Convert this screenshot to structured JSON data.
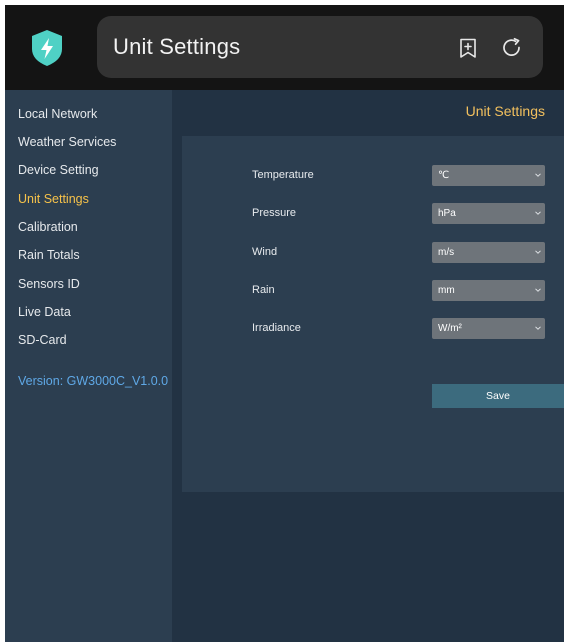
{
  "header": {
    "title": "Unit Settings"
  },
  "sidebar": {
    "items": [
      {
        "label": "Local Network",
        "active": false
      },
      {
        "label": "Weather Services",
        "active": false
      },
      {
        "label": "Device Setting",
        "active": false
      },
      {
        "label": "Unit Settings",
        "active": true
      },
      {
        "label": "Calibration",
        "active": false
      },
      {
        "label": "Rain Totals",
        "active": false
      },
      {
        "label": "Sensors ID",
        "active": false
      },
      {
        "label": "Live Data",
        "active": false
      },
      {
        "label": "SD-Card",
        "active": false
      }
    ],
    "version": "Version: GW3000C_V1.0.0"
  },
  "main": {
    "heading": "Unit Settings",
    "fields": [
      {
        "label": "Temperature",
        "value": "℃"
      },
      {
        "label": "Pressure",
        "value": "hPa"
      },
      {
        "label": "Wind",
        "value": "m/s"
      },
      {
        "label": "Rain",
        "value": "mm"
      },
      {
        "label": "Irradiance",
        "value": "W/m²"
      }
    ],
    "save_label": "Save"
  },
  "icons": {
    "app": "lightning-shield-icon",
    "bookmark": "bookmark-plus-icon",
    "refresh": "refresh-icon",
    "dropdown": "chevron-down-icon"
  },
  "colors": {
    "top_bar": "#141414",
    "sidebar_bg": "#2c3e50",
    "main_bg": "#223243",
    "panel_bg": "#2c3e50",
    "active_item": "#f6c24a",
    "heading": "#f2c05e",
    "version_link": "#5fa8e6",
    "app_icon": "#4fd1c5",
    "select_bg": "#6e747a",
    "save_button": "#3c6b7e"
  }
}
